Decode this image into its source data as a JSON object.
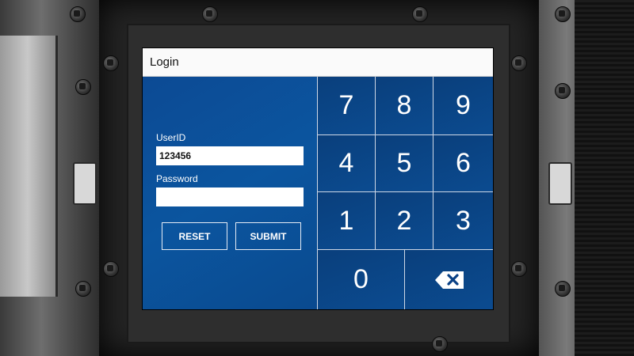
{
  "window": {
    "title": "Login"
  },
  "login": {
    "userid_label": "UserID",
    "userid_value": "123456",
    "password_label": "Password",
    "password_value": "",
    "reset_label": "RESET",
    "submit_label": "SUBMIT"
  },
  "keypad": {
    "rows": [
      [
        "7",
        "8",
        "9"
      ],
      [
        "4",
        "5",
        "6"
      ],
      [
        "1",
        "2",
        "3"
      ]
    ],
    "zero": "0",
    "backspace_icon": "backspace-icon"
  },
  "colors": {
    "panel_blue": "#0b4a92",
    "key_blue": "#0a4186",
    "divider": "#cfd8e6"
  }
}
